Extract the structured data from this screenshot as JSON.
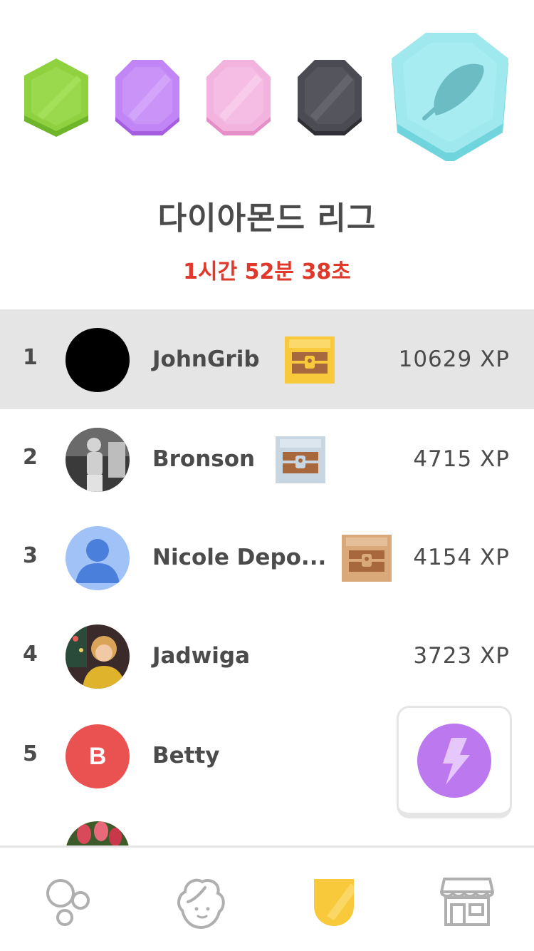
{
  "league": {
    "title": "다이아몬드 리그",
    "timer": "1시간 52분 38초",
    "badges": [
      {
        "name": "emerald",
        "color": "#8fd13f"
      },
      {
        "name": "amethyst",
        "color": "#c185f6"
      },
      {
        "name": "pearl",
        "color": "#f3b3df"
      },
      {
        "name": "obsidian",
        "color": "#4b4b53"
      },
      {
        "name": "diamond",
        "color": "#9ee8ee",
        "icon": "feather-icon",
        "current": true
      }
    ]
  },
  "leaderboard": [
    {
      "rank": "1",
      "name": "JohnGrib",
      "xp": "10629 XP",
      "chest": "gold",
      "highlight": true
    },
    {
      "rank": "2",
      "name": "Bronson",
      "xp": "4715 XP",
      "chest": "silver"
    },
    {
      "rank": "3",
      "name": "Nicole Depo...",
      "xp": "4154 XP",
      "chest": "bronze"
    },
    {
      "rank": "4",
      "name": "Jadwiga",
      "xp": "3723 XP"
    },
    {
      "rank": "5",
      "name": "Betty",
      "xp": "",
      "avatar_letter": "B"
    }
  ],
  "colors": {
    "timer": "#e0392b",
    "highlight_row": "#e5e5e5",
    "gold_chest": "#f7c93b",
    "silver_chest": "#c7d6e1",
    "bronze_chest": "#d9a97a",
    "avatar_b": "#ea5151",
    "power_up": "#c07cf2",
    "active_tab": "#f7c93b"
  },
  "tabbar": {
    "items": [
      {
        "icon": "bubbles-icon",
        "active": false
      },
      {
        "icon": "character-icon",
        "active": false
      },
      {
        "icon": "league-shield-icon",
        "active": true
      },
      {
        "icon": "shop-icon",
        "active": false
      }
    ]
  }
}
